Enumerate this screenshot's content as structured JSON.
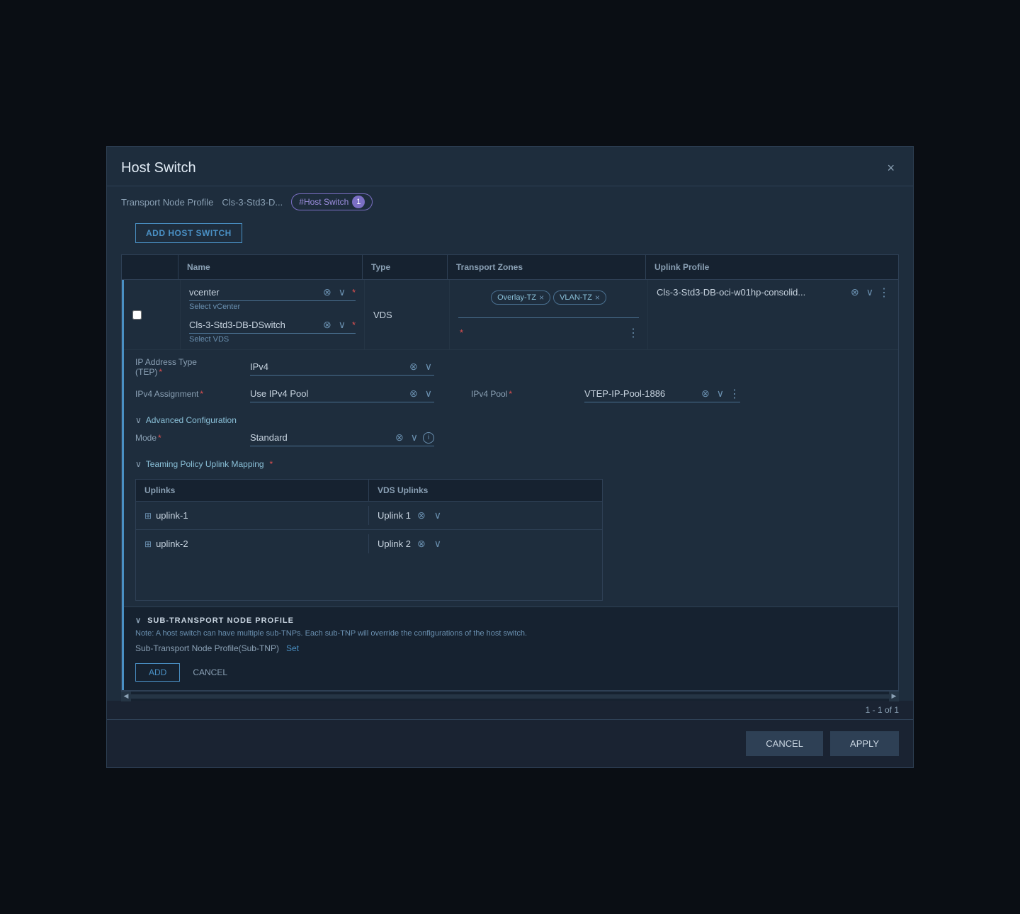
{
  "modal": {
    "title": "Host Switch",
    "close_label": "×",
    "breadcrumb": {
      "label1": "Transport Node Profile",
      "value1": "Cls-3-Std3-D...",
      "tag": "#Host Switch",
      "tag_count": "1"
    },
    "add_host_switch_label": "ADD HOST SWITCH"
  },
  "table": {
    "headers": [
      "",
      "Name",
      "Type",
      "Transport Zones",
      "Uplink Profile"
    ],
    "row": {
      "vcenter_label": "vcenter",
      "select_vcenter": "Select vCenter",
      "type": "VDS",
      "vds_label": "Cls-3-Std3-DB-DSwitch",
      "select_vds": "Select VDS",
      "transport_zones": [
        {
          "label": "Overlay-TZ"
        },
        {
          "label": "VLAN-TZ"
        }
      ],
      "uplink_profile": "Cls-3-Std3-DB-oci-w01hp-consolid...",
      "ip_address_type_label": "IP Address Type\n(TEP)",
      "ip_address_type_value": "IPv4",
      "ipv4_assignment_label": "IPv4 Assignment",
      "ipv4_assignment_value": "Use IPv4 Pool",
      "ipv4_pool_label": "IPv4 Pool",
      "ipv4_pool_value": "VTEP-IP-Pool-1886",
      "advanced_config_label": "Advanced Configuration",
      "mode_label": "Mode",
      "mode_value": "Standard",
      "teaming_policy_label": "Teaming Policy Uplink Mapping",
      "teaming": {
        "headers": [
          "Uplinks",
          "VDS Uplinks"
        ],
        "rows": [
          {
            "uplink": "uplink-1",
            "vds_uplink": "Uplink 1"
          },
          {
            "uplink": "uplink-2",
            "vds_uplink": "Uplink 2"
          }
        ]
      },
      "sub_transport_title": "SUB-TRANSPORT NODE PROFILE",
      "sub_transport_note": "Note: A host switch can have multiple sub-TNPs. Each sub-TNP will override the configurations of the host switch.",
      "sub_transport_profile_label": "Sub-Transport Node Profile(Sub-TNP)",
      "sub_transport_set": "Set",
      "add_btn": "ADD",
      "cancel_btn": "CANCEL"
    }
  },
  "pagination": {
    "text": "1 - 1 of 1"
  },
  "footer": {
    "cancel_label": "CANCEL",
    "apply_label": "APPLY"
  }
}
